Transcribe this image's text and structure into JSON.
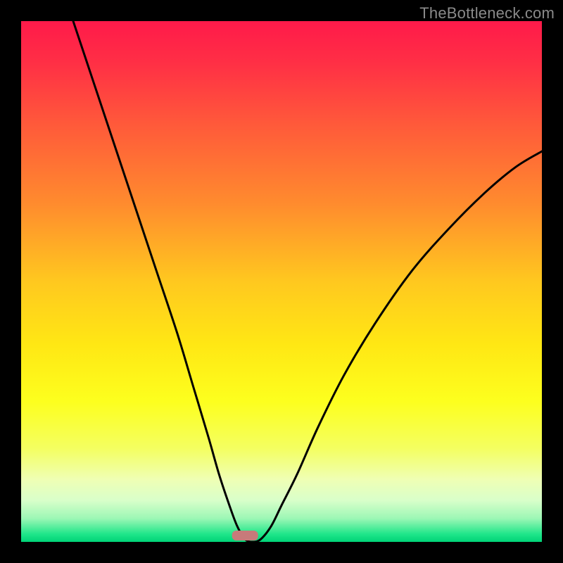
{
  "watermark": "TheBottleneck.com",
  "colors": {
    "frame": "#000000",
    "curve": "#000000",
    "marker": "#c77a7a"
  },
  "chart_data": {
    "type": "line",
    "title": "",
    "xlabel": "",
    "ylabel": "",
    "xlim": [
      0,
      100
    ],
    "ylim": [
      0,
      100
    ],
    "marker": {
      "x": 43,
      "y": 0,
      "width": 5,
      "height": 2
    },
    "gradient_stops": [
      {
        "offset": 0.0,
        "color": "#ff1a4a"
      },
      {
        "offset": 0.08,
        "color": "#ff2f45"
      },
      {
        "offset": 0.2,
        "color": "#ff5a3a"
      },
      {
        "offset": 0.35,
        "color": "#ff8b2e"
      },
      {
        "offset": 0.5,
        "color": "#ffc81f"
      },
      {
        "offset": 0.62,
        "color": "#ffe714"
      },
      {
        "offset": 0.73,
        "color": "#fdff1e"
      },
      {
        "offset": 0.82,
        "color": "#f4ff60"
      },
      {
        "offset": 0.88,
        "color": "#efffb4"
      },
      {
        "offset": 0.92,
        "color": "#d9ffca"
      },
      {
        "offset": 0.955,
        "color": "#9cf7b5"
      },
      {
        "offset": 0.985,
        "color": "#1fe68a"
      },
      {
        "offset": 1.0,
        "color": "#00d377"
      }
    ],
    "series": [
      {
        "name": "bottleneck-curve",
        "points": [
          {
            "x": 10,
            "y": 100
          },
          {
            "x": 14,
            "y": 88
          },
          {
            "x": 18,
            "y": 76
          },
          {
            "x": 22,
            "y": 64
          },
          {
            "x": 26,
            "y": 52
          },
          {
            "x": 30,
            "y": 40
          },
          {
            "x": 33,
            "y": 30
          },
          {
            "x": 36,
            "y": 20
          },
          {
            "x": 38,
            "y": 13
          },
          {
            "x": 40,
            "y": 7
          },
          {
            "x": 41.5,
            "y": 3
          },
          {
            "x": 43,
            "y": 0.5
          },
          {
            "x": 44.5,
            "y": 0
          },
          {
            "x": 46,
            "y": 0.5
          },
          {
            "x": 48,
            "y": 3
          },
          {
            "x": 50,
            "y": 7
          },
          {
            "x": 53,
            "y": 13
          },
          {
            "x": 57,
            "y": 22
          },
          {
            "x": 62,
            "y": 32
          },
          {
            "x": 68,
            "y": 42
          },
          {
            "x": 75,
            "y": 52
          },
          {
            "x": 82,
            "y": 60
          },
          {
            "x": 89,
            "y": 67
          },
          {
            "x": 95,
            "y": 72
          },
          {
            "x": 100,
            "y": 75
          }
        ]
      }
    ]
  }
}
